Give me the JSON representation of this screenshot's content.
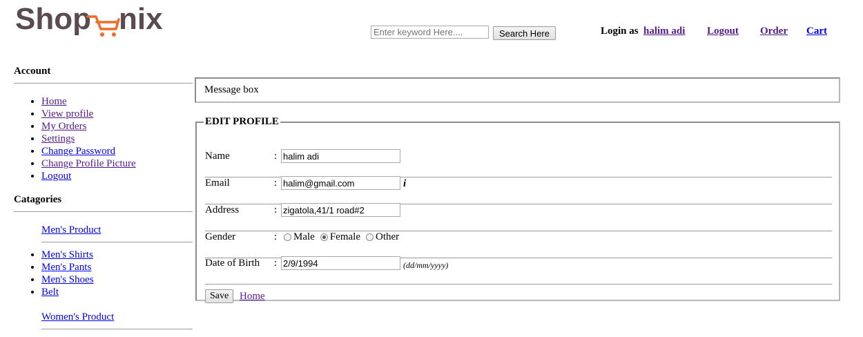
{
  "brand": {
    "logo_text": "Shopnix"
  },
  "search": {
    "placeholder": "Enter keyword Here....",
    "button_label": "Search Here"
  },
  "header": {
    "login_label": "Login as",
    "username": "halim adi",
    "logout": "Logout",
    "order": "Order",
    "cart": "Cart"
  },
  "sidebar": {
    "account_heading": "Account",
    "account_items": [
      {
        "label": "Home"
      },
      {
        "label": "View profile"
      },
      {
        "label": "My Orders"
      },
      {
        "label": "Settings"
      },
      {
        "label": "Change Password"
      },
      {
        "label": "Change Profile Picture"
      },
      {
        "label": "Logout"
      }
    ],
    "categories_heading": "Catagories",
    "mens_product": "Men's Product",
    "mens_items": [
      {
        "label": "Men's Shirts"
      },
      {
        "label": "Men's Pants"
      },
      {
        "label": "Men's Shoes"
      },
      {
        "label": "Belt"
      }
    ],
    "womens_product": "Women's Product"
  },
  "message_box": {
    "text": "Message box"
  },
  "profile": {
    "legend": "EDIT PROFILE",
    "colon": ":",
    "name": {
      "label": "Name",
      "value": "halim adi"
    },
    "email": {
      "label": "Email",
      "value": "halim@gmail.com",
      "info_icon": "i"
    },
    "address": {
      "label": "Address",
      "value": "zigatola,41/1 road#2"
    },
    "gender": {
      "label": "Gender",
      "options": [
        "Male",
        "Female",
        "Other"
      ],
      "selected": "Female"
    },
    "dob": {
      "label": "Date of Birth",
      "value": "2/9/1994",
      "hint": "(dd/mm/yyyy)"
    },
    "save_label": "Save",
    "home_link": "Home"
  },
  "colors": {
    "link": "#0000ee",
    "visited_link": "#551a8b",
    "logo_dark": "#5a4b50",
    "logo_accent": "#f06a28"
  }
}
